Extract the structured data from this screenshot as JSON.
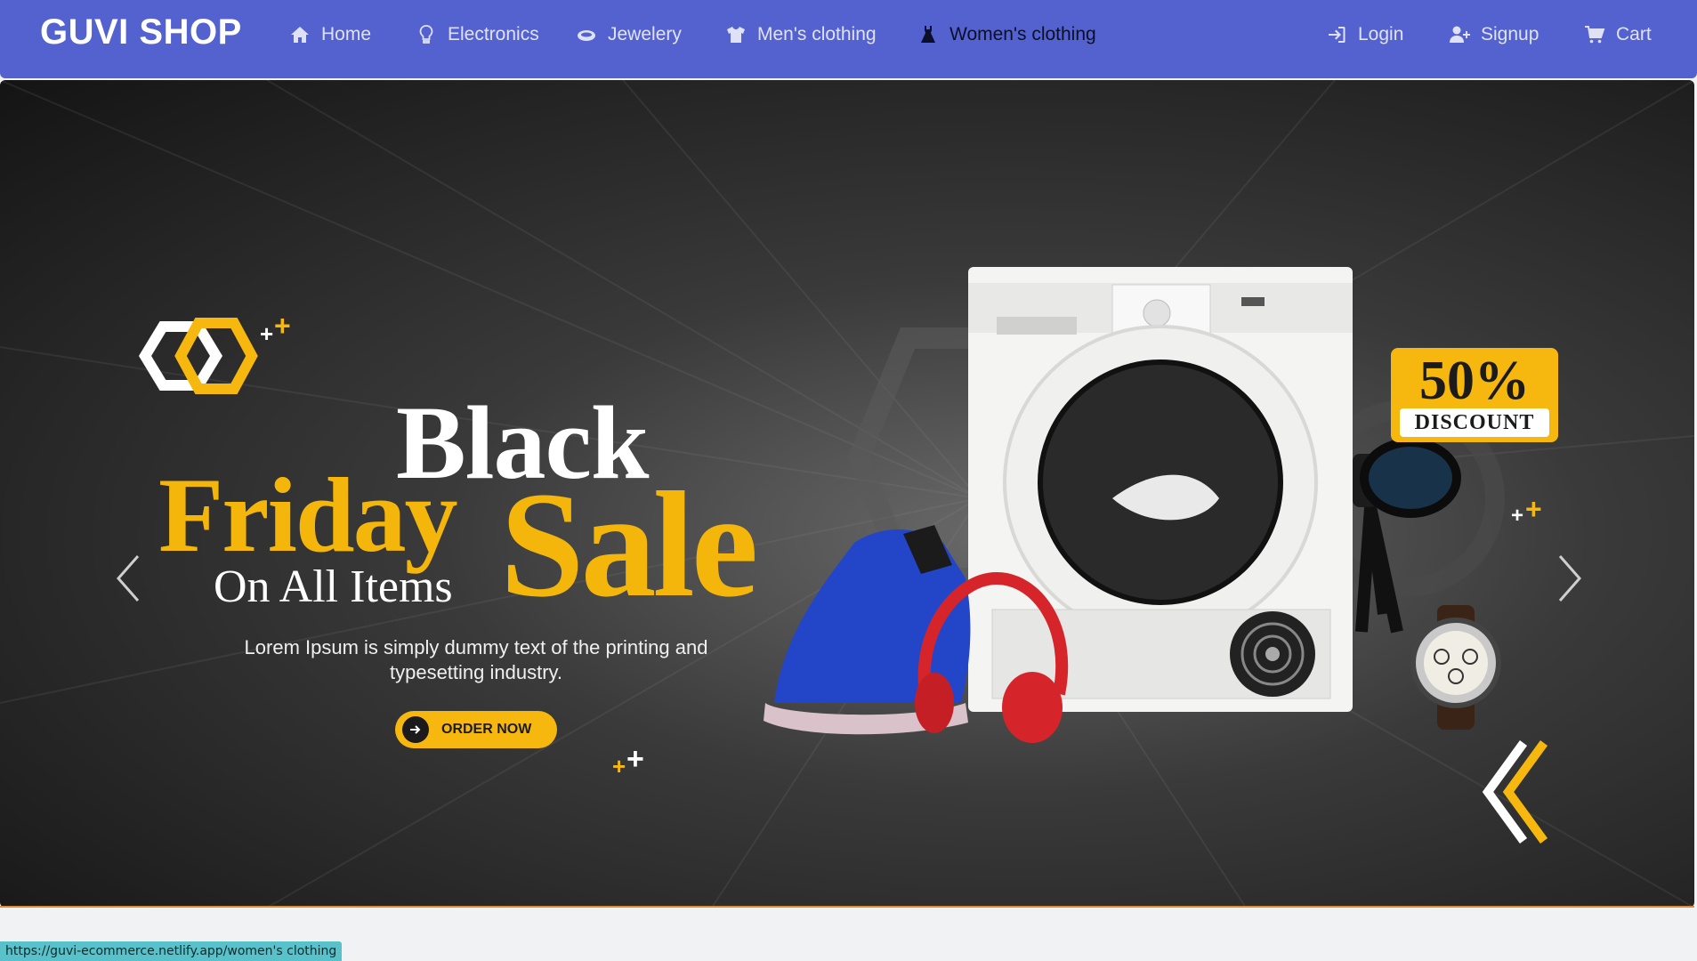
{
  "navbar": {
    "brand": "GUVI SHOP",
    "items": [
      {
        "label": "Home",
        "icon": "home-icon"
      },
      {
        "label": "Electronics",
        "icon": "lightbulb-icon"
      },
      {
        "label": "Jewelery",
        "icon": "ring-icon"
      },
      {
        "label": "Men's clothing",
        "icon": "tshirt-icon"
      },
      {
        "label": "Women's clothing",
        "icon": "dress-icon",
        "active": true
      }
    ],
    "right_items": [
      {
        "label": "Login",
        "icon": "login-icon"
      },
      {
        "label": "Signup",
        "icon": "user-plus-icon"
      },
      {
        "label": "Cart",
        "icon": "cart-icon"
      }
    ]
  },
  "hero": {
    "line_black": "Black",
    "line_friday": "Friday",
    "line_sale": "Sale",
    "line_on_all": "On All Items",
    "description": "Lorem Ipsum is simply dummy text of the printing and typesetting industry.",
    "cta_label": "ORDER NOW",
    "discount_percent": "50%",
    "discount_label": "DISCOUNT"
  },
  "status_bar": {
    "url": "https://guvi-ecommerce.netlify.app/women's clothing"
  },
  "colors": {
    "navbar_bg": "#5462d0",
    "accent_yellow": "#f6b70e",
    "status_bg": "#58c1c9"
  }
}
